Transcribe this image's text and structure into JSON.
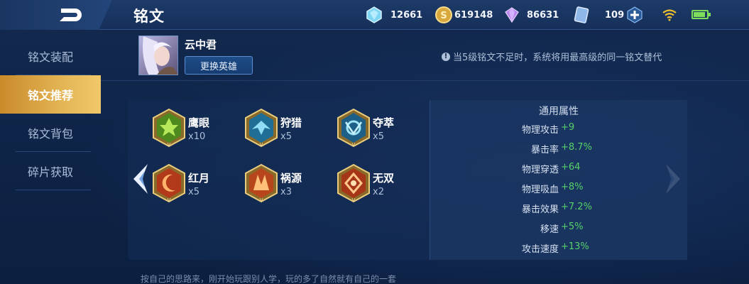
{
  "header": {
    "title": "铭文",
    "resources": [
      {
        "icon": "diamond-icon",
        "value": "12661"
      },
      {
        "icon": "gold-coin-icon",
        "value": "619148"
      },
      {
        "icon": "purple-crystal-icon",
        "value": "86631"
      },
      {
        "icon": "ticket-card-icon",
        "value": "109"
      }
    ]
  },
  "sidebar": {
    "items": [
      {
        "label": "铭文装配",
        "active": false
      },
      {
        "label": "铭文推荐",
        "active": true
      },
      {
        "label": "铭文背包",
        "active": false
      },
      {
        "label": "碎片获取",
        "active": false
      }
    ]
  },
  "hero": {
    "name": "云中君",
    "change_button": "更换英雄"
  },
  "notice": "当5级铭文不足时，系统将用最高级的同一铭文替代",
  "runes": [
    {
      "name": "鹰眼",
      "count": "x10",
      "color": "green",
      "icon": "eagle-eye-rune-icon"
    },
    {
      "name": "狩猎",
      "count": "x5",
      "color": "blue",
      "icon": "hunt-rune-icon"
    },
    {
      "name": "夺萃",
      "count": "x5",
      "color": "blue",
      "icon": "plunder-rune-icon"
    },
    {
      "name": "红月",
      "count": "x5",
      "color": "red",
      "icon": "red-moon-rune-icon"
    },
    {
      "name": "祸源",
      "count": "x3",
      "color": "red",
      "icon": "calamity-rune-icon"
    },
    {
      "name": "无双",
      "count": "x2",
      "color": "red",
      "icon": "unrivaled-rune-icon"
    }
  ],
  "attributes": {
    "title": "通用属性",
    "rows": [
      {
        "key": "物理攻击",
        "value": "+9"
      },
      {
        "key": "暴击率",
        "value": "+8.7%"
      },
      {
        "key": "物理穿透",
        "value": "+64"
      },
      {
        "key": "物理吸血",
        "value": "+8%"
      },
      {
        "key": "暴击效果",
        "value": "+7.2%"
      },
      {
        "key": "移速",
        "value": "+5%"
      },
      {
        "key": "攻击速度",
        "value": "+13%"
      }
    ]
  },
  "tip": "按自己的思路来，刚开始玩跟别人学，玩的多了自然就有自己的一套",
  "colors": {
    "accent_gold": "#e3b454",
    "attr_value_green": "#56d06a",
    "rune_green": "#7cc43a",
    "rune_blue": "#56b6d8",
    "rune_red": "#e0642a"
  }
}
